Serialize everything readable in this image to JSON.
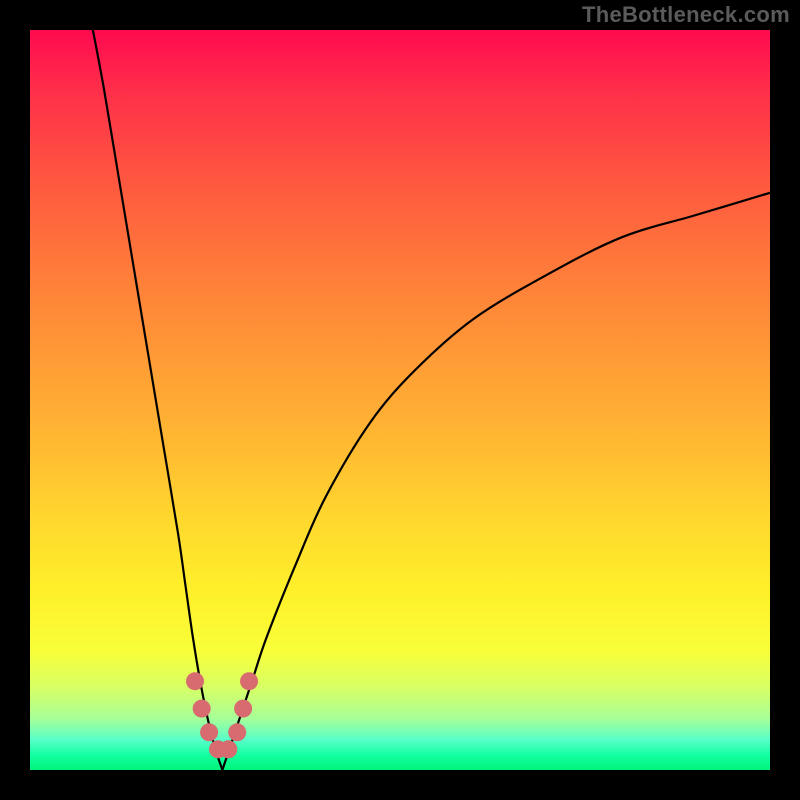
{
  "watermark": "TheBottleneck.com",
  "chart_data": {
    "type": "line",
    "title": "",
    "xlabel": "",
    "ylabel": "",
    "xlim": [
      0,
      100
    ],
    "ylim": [
      0,
      100
    ],
    "notch": {
      "x_center": 26,
      "y_min": 0,
      "left_x_top": 8.5,
      "left_y_top": 100,
      "right_x_top": 100,
      "right_y_top": 78
    },
    "series": [
      {
        "name": "left-arm",
        "role": "curve",
        "x": [
          8.5,
          10,
          12,
          14,
          16,
          18,
          20,
          21,
          22,
          23,
          24,
          25,
          26
        ],
        "y": [
          100,
          92,
          80,
          68,
          56,
          44,
          32,
          25,
          18,
          12,
          7,
          3,
          0
        ]
      },
      {
        "name": "right-arm",
        "role": "curve",
        "x": [
          26,
          28,
          30,
          32,
          36,
          40,
          46,
          52,
          60,
          70,
          80,
          90,
          100
        ],
        "y": [
          0,
          6,
          12,
          18,
          28,
          37,
          47,
          54,
          61,
          67,
          72,
          75,
          78
        ]
      },
      {
        "name": "notch-marker",
        "role": "marker-run",
        "x": [
          22.3,
          23.2,
          24.2,
          25.4,
          26.8,
          28.0,
          28.8,
          29.6
        ],
        "y": [
          12.0,
          8.3,
          5.1,
          2.8,
          2.8,
          5.1,
          8.3,
          12.0
        ]
      }
    ],
    "marker_style": {
      "color": "#d76b6f",
      "radius_px": 9
    },
    "background": "rainbow-vertical-gradient"
  }
}
